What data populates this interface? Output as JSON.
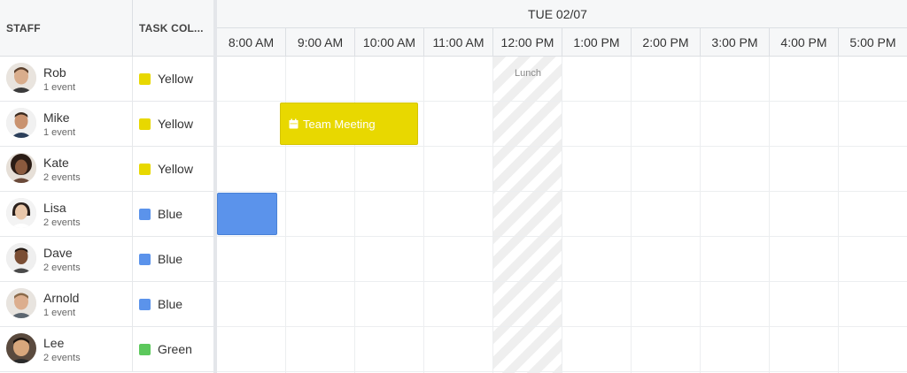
{
  "headers": {
    "staff": "STAFF",
    "task_color": "TASK COL..."
  },
  "date_label": "TUE 02/07",
  "times": [
    "8:00 AM",
    "9:00 AM",
    "10:00 AM",
    "11:00 AM",
    "12:00 PM",
    "1:00 PM",
    "2:00 PM",
    "3:00 PM",
    "4:00 PM",
    "5:00 PM"
  ],
  "staff": [
    {
      "name": "Rob",
      "events": "1 event",
      "color_name": "Yellow",
      "color": "#e8d800"
    },
    {
      "name": "Mike",
      "events": "1 event",
      "color_name": "Yellow",
      "color": "#e8d800"
    },
    {
      "name": "Kate",
      "events": "2 events",
      "color_name": "Yellow",
      "color": "#e8d800"
    },
    {
      "name": "Lisa",
      "events": "2 events",
      "color_name": "Blue",
      "color": "#5b93eb"
    },
    {
      "name": "Dave",
      "events": "2 events",
      "color_name": "Blue",
      "color": "#5b93eb"
    },
    {
      "name": "Arnold",
      "events": "1 event",
      "color_name": "Blue",
      "color": "#5b93eb"
    },
    {
      "name": "Lee",
      "events": "2 events",
      "color_name": "Green",
      "color": "#5cc85c"
    }
  ],
  "lunch_label": "Lunch",
  "events": {
    "team_meeting": {
      "title": "Team Meeting",
      "icon": "calendar-icon",
      "color": "#e8d800"
    },
    "blue_event": {
      "color": "#5b93eb"
    }
  }
}
